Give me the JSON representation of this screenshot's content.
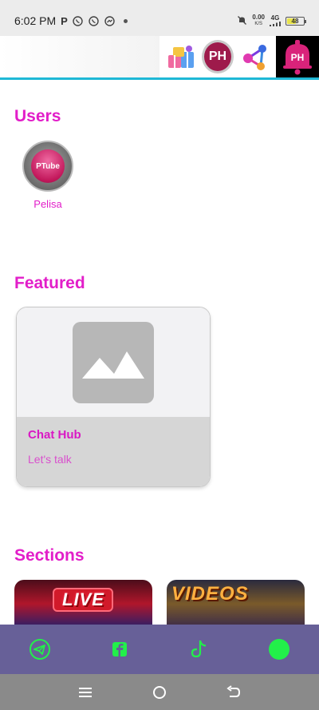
{
  "status_bar": {
    "time": "6:02 PM",
    "p_indicator": "P",
    "data_speed": "0.00",
    "data_unit": "K/S",
    "network": "4G",
    "battery": "48",
    "battery_fraction": 0.48,
    "icons": [
      "whatsapp-icon",
      "whatsapp-icon",
      "messenger-icon",
      "dot-icon",
      "mute-bell-icon",
      "signal-icon",
      "battery-icon"
    ]
  },
  "header": {
    "app_icons": [
      {
        "name": "gifts-app-icon"
      },
      {
        "name": "ph-app-icon",
        "label": "PH"
      },
      {
        "name": "share-network-icon"
      },
      {
        "name": "notification-bell-icon",
        "label": "PH"
      }
    ],
    "accent_color": "#1eb8d6"
  },
  "sections": {
    "users_title": "Users",
    "featured_title": "Featured",
    "sections_title": "Sections"
  },
  "users": [
    {
      "name": "Pelisa",
      "avatar_text": "PTube"
    }
  ],
  "featured": [
    {
      "title": "Chat Hub",
      "subtitle": "Let's talk",
      "image": "image-placeholder-icon"
    }
  ],
  "section_items": [
    {
      "label": "LIVE"
    },
    {
      "label": "VIDEOS"
    }
  ],
  "bottom_nav": {
    "items": [
      "telegram-icon",
      "facebook-icon",
      "tiktok-icon",
      "status-dot"
    ],
    "background": "#676098",
    "icon_color": "#22f04a"
  },
  "system_nav": {
    "items": [
      "menu-icon",
      "home-icon",
      "back-icon"
    ]
  },
  "colors": {
    "title": "#e21ec9",
    "card_footer": "#d6d6d6"
  }
}
